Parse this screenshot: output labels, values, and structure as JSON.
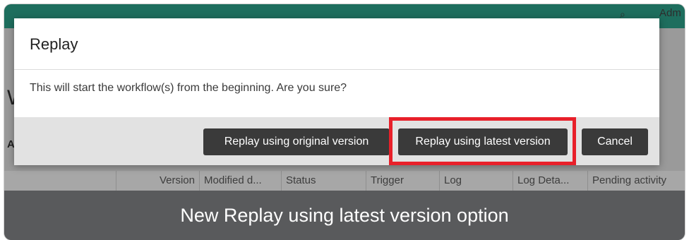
{
  "header": {
    "user_fragment": "Adm"
  },
  "page": {
    "heading_fragment": "W",
    "label_fragment": "A"
  },
  "table": {
    "columns": [
      "Version",
      "Modified d...",
      "Status",
      "Trigger",
      "Log",
      "Log Deta...",
      "Pending activity"
    ]
  },
  "dialog": {
    "title": "Replay",
    "message": "This will start the workflow(s) from the beginning. Are you sure?",
    "buttons": {
      "replay_original": "Replay using original version",
      "replay_latest": "Replay using latest version",
      "cancel": "Cancel"
    }
  },
  "caption": "New Replay using latest version option",
  "colors": {
    "header_bg": "#1e6e5e",
    "highlight": "#e8202a",
    "button_bg": "#3a3a3a",
    "caption_bg": "#595a5c"
  },
  "icons": {
    "search": "search-icon"
  }
}
